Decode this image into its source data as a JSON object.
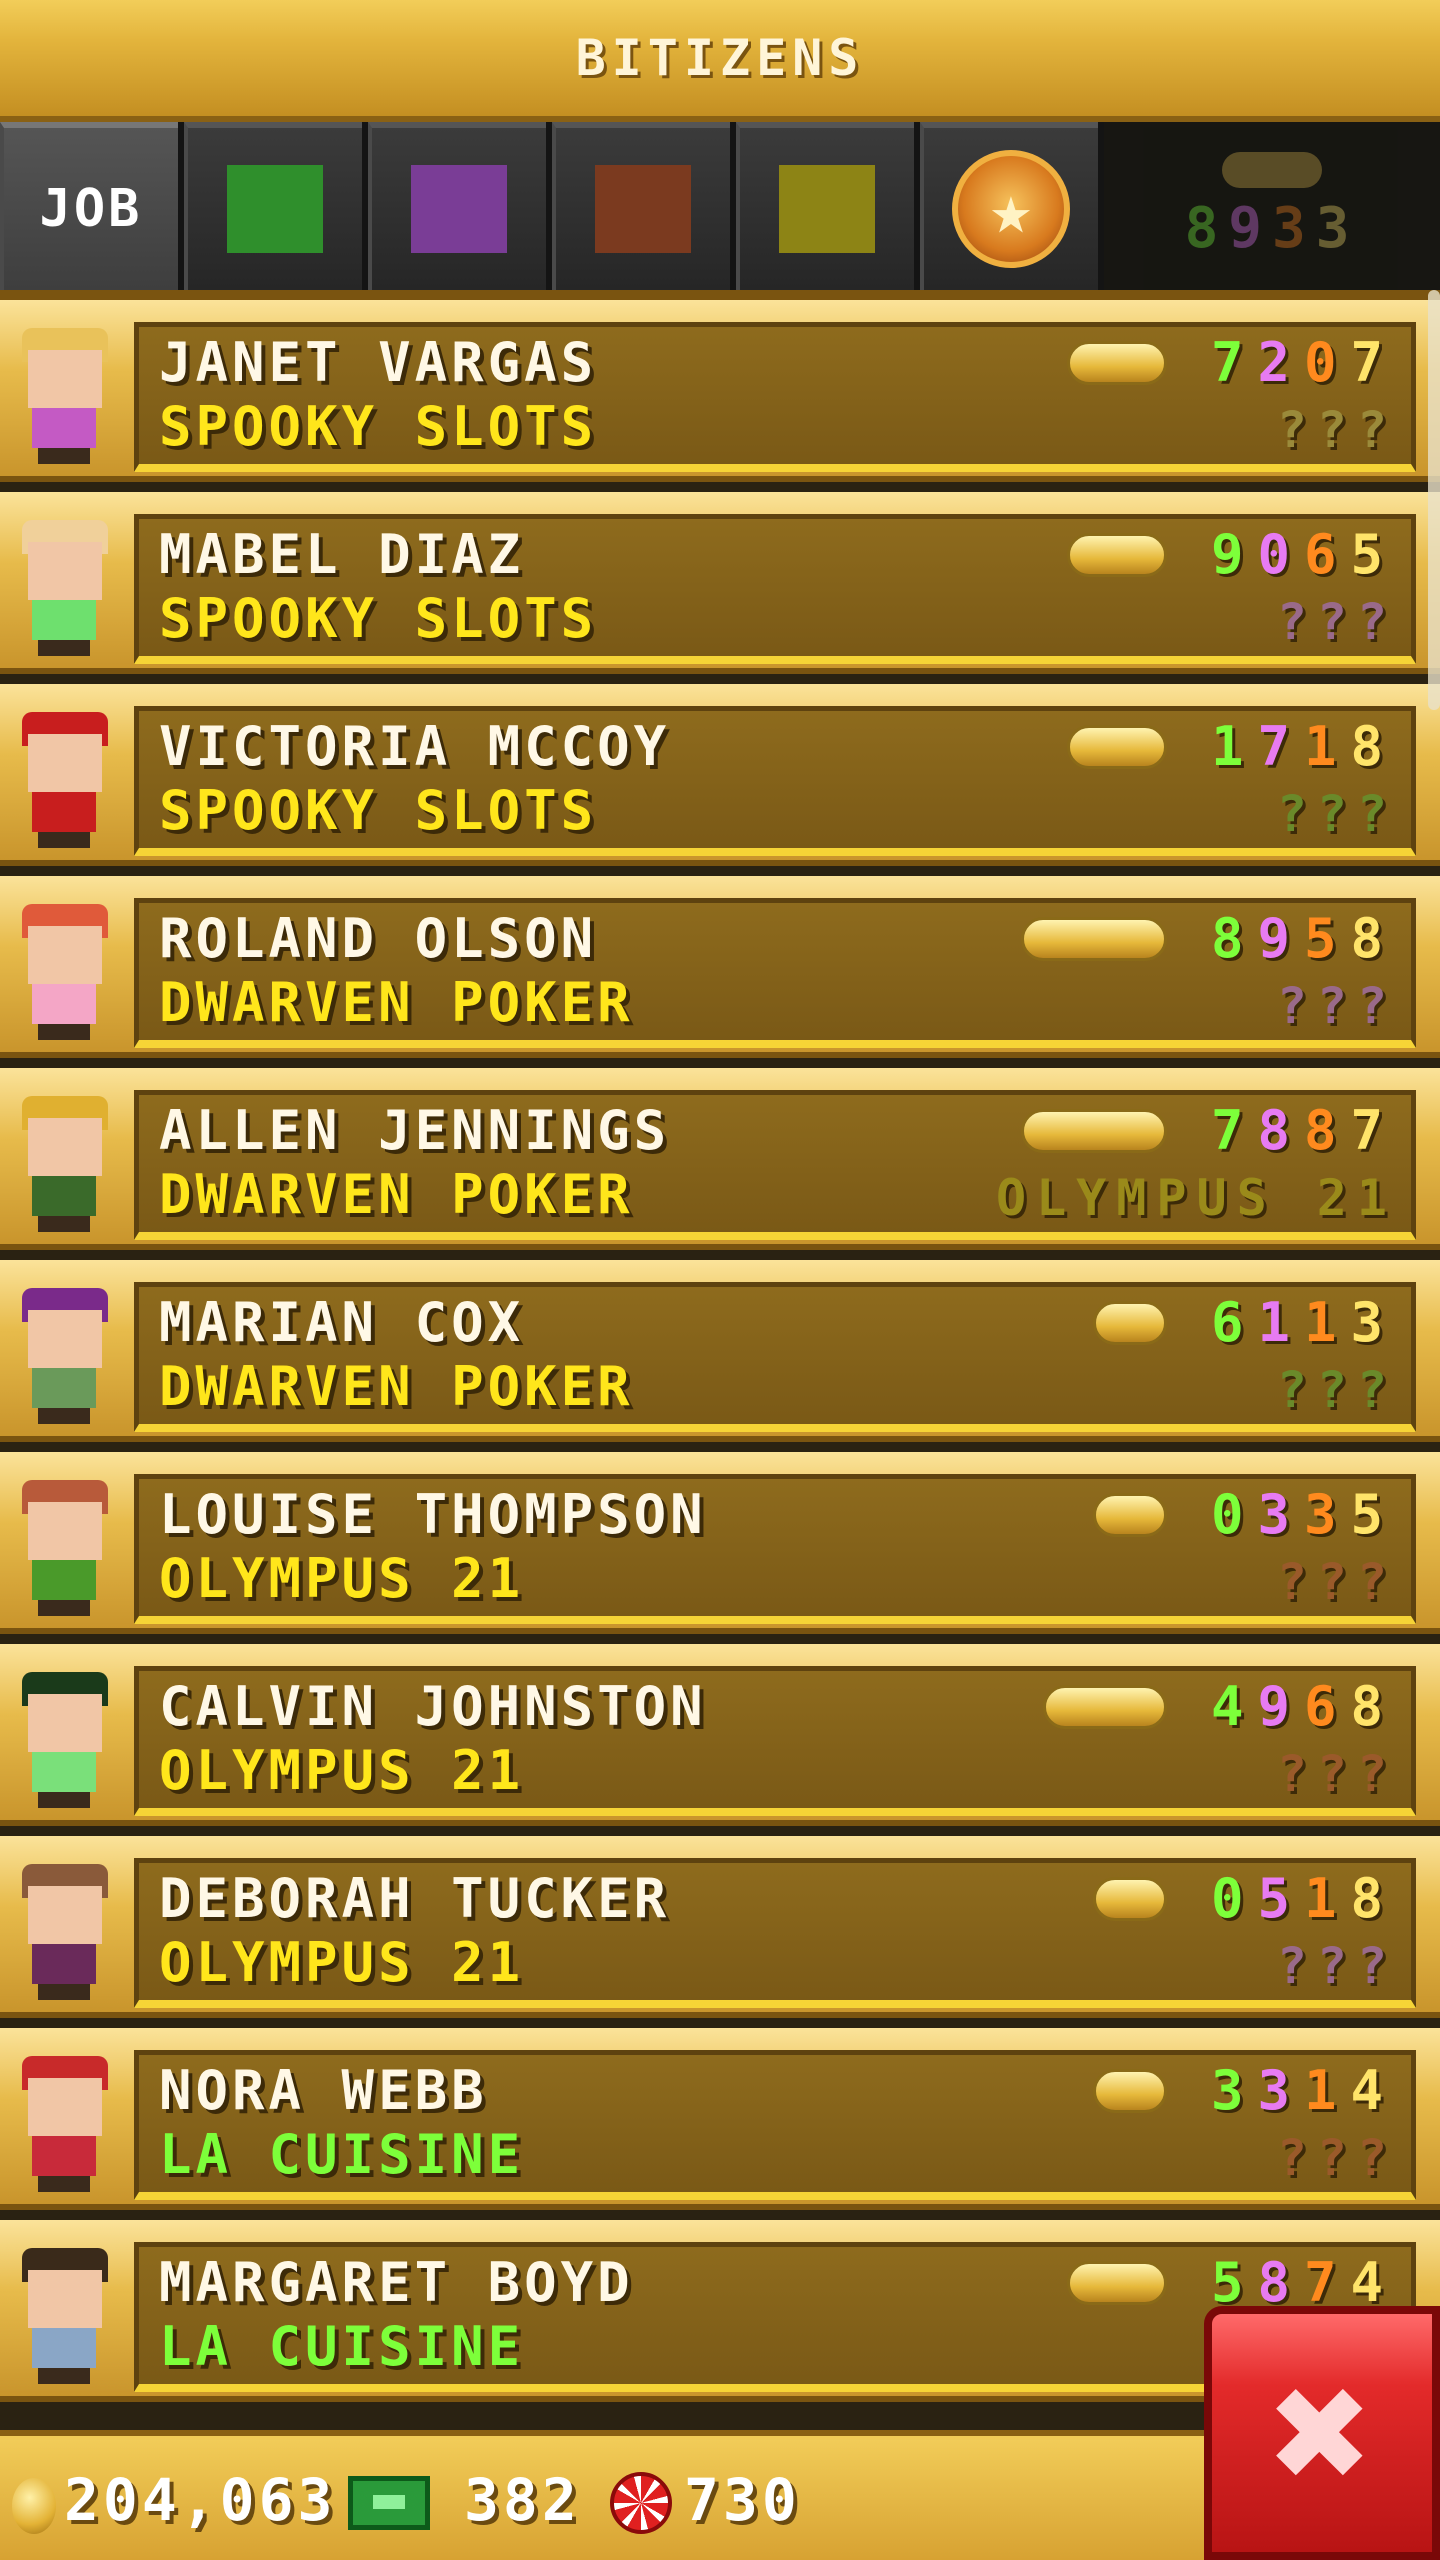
{
  "header": {
    "title": "BITIZENS"
  },
  "tabs": {
    "job_label": "JOB",
    "swatches": [
      {
        "name": "green-filter",
        "color": "#2f8f2c"
      },
      {
        "name": "purple-filter",
        "color": "#7a3d96"
      },
      {
        "name": "orange-filter",
        "color": "#7b3a1f"
      },
      {
        "name": "yellow-filter",
        "color": "#8d8415"
      }
    ],
    "star_icon": "star-badge-icon",
    "sort_digits": "8933"
  },
  "colors": {
    "stat_green": "#7dff3a",
    "stat_purple": "#e77bf2",
    "stat_orange": "#ff8a1e",
    "stat_yellow": "#ffe46a",
    "job_yellow": "#ffe61b",
    "job_green": "#7dff3a"
  },
  "bitizens": [
    {
      "name": "JANET VARGAS",
      "job": "SPOOKY SLOTS",
      "job_color": "#ffe61b",
      "stats": [
        "7",
        "2",
        "0",
        "7"
      ],
      "dream": "???",
      "dream_color": "#9a8a3a",
      "hair": "#e9c25a",
      "shirt": "#c45ac4",
      "coin_w": 100
    },
    {
      "name": "MABEL DIAZ",
      "job": "SPOOKY SLOTS",
      "job_color": "#ffe61b",
      "stats": [
        "9",
        "0",
        "6",
        "5"
      ],
      "dream": "???",
      "dream_color": "#9a6a8a",
      "hair": "#f0d09a",
      "shirt": "#6ee06e",
      "coin_w": 100
    },
    {
      "name": "VICTORIA MCCOY",
      "job": "SPOOKY SLOTS",
      "job_color": "#ffe61b",
      "stats": [
        "1",
        "7",
        "1",
        "8"
      ],
      "dream": "???",
      "dream_color": "#6a8a2a",
      "hair": "#c81e1e",
      "shirt": "#c81e1e",
      "coin_w": 100
    },
    {
      "name": "ROLAND OLSON",
      "job": "DWARVEN POKER",
      "job_color": "#ffe61b",
      "stats": [
        "8",
        "9",
        "5",
        "8"
      ],
      "dream": "???",
      "dream_color": "#9a6a8a",
      "hair": "#e05a3a",
      "shirt": "#f4a6c6",
      "coin_w": 146
    },
    {
      "name": "ALLEN JENNINGS",
      "job": "DWARVEN POKER",
      "job_color": "#ffe61b",
      "stats": [
        "7",
        "8",
        "8",
        "7"
      ],
      "dream": "OLYMPUS 21",
      "dream_color": "#9a8a1a",
      "hair": "#e0b030",
      "shirt": "#3a6a2a",
      "coin_w": 146
    },
    {
      "name": "MARIAN COX",
      "job": "DWARVEN POKER",
      "job_color": "#ffe61b",
      "stats": [
        "6",
        "1",
        "1",
        "3"
      ],
      "dream": "???",
      "dream_color": "#6a8a2a",
      "hair": "#7a2a8a",
      "shirt": "#6a9a5a",
      "coin_w": 74
    },
    {
      "name": "LOUISE THOMPSON",
      "job": "OLYMPUS 21",
      "job_color": "#ffe61b",
      "stats": [
        "0",
        "3",
        "3",
        "5"
      ],
      "dream": "???",
      "dream_color": "#9a5a2a",
      "hair": "#b85a3a",
      "shirt": "#4a9a2a",
      "coin_w": 74
    },
    {
      "name": "CALVIN JOHNSTON",
      "job": "OLYMPUS 21",
      "job_color": "#ffe61b",
      "stats": [
        "4",
        "9",
        "6",
        "8"
      ],
      "dream": "???",
      "dream_color": "#9a5a2a",
      "hair": "#1a3a1a",
      "shirt": "#7ae07a",
      "coin_w": 124
    },
    {
      "name": "DEBORAH TUCKER",
      "job": "OLYMPUS 21",
      "job_color": "#ffe61b",
      "stats": [
        "0",
        "5",
        "1",
        "8"
      ],
      "dream": "???",
      "dream_color": "#9a6a8a",
      "hair": "#8a5a3a",
      "shirt": "#6a2a5a",
      "coin_w": 74
    },
    {
      "name": "NORA WEBB",
      "job": "LA CUISINE",
      "job_color": "#7dff3a",
      "stats": [
        "3",
        "3",
        "1",
        "4"
      ],
      "dream": "???",
      "dream_color": "#9a5a2a",
      "hair": "#c82a2a",
      "shirt": "#c82a3a",
      "coin_w": 74
    },
    {
      "name": "MARGARET BOYD",
      "job": "LA CUISINE",
      "job_color": "#7dff3a",
      "stats": [
        "5",
        "8",
        "7",
        "4"
      ],
      "dream": "",
      "dream_color": "#9a5a2a",
      "hair": "#3a2a1a",
      "shirt": "#8aa6c6",
      "coin_w": 100
    }
  ],
  "footer": {
    "coins": "204,063",
    "bux": "382",
    "chips": "730",
    "coin_icon": "coin-icon",
    "bux_icon": "bux-icon",
    "chip_icon": "poker-chip-icon",
    "close_icon": "close-icon"
  }
}
